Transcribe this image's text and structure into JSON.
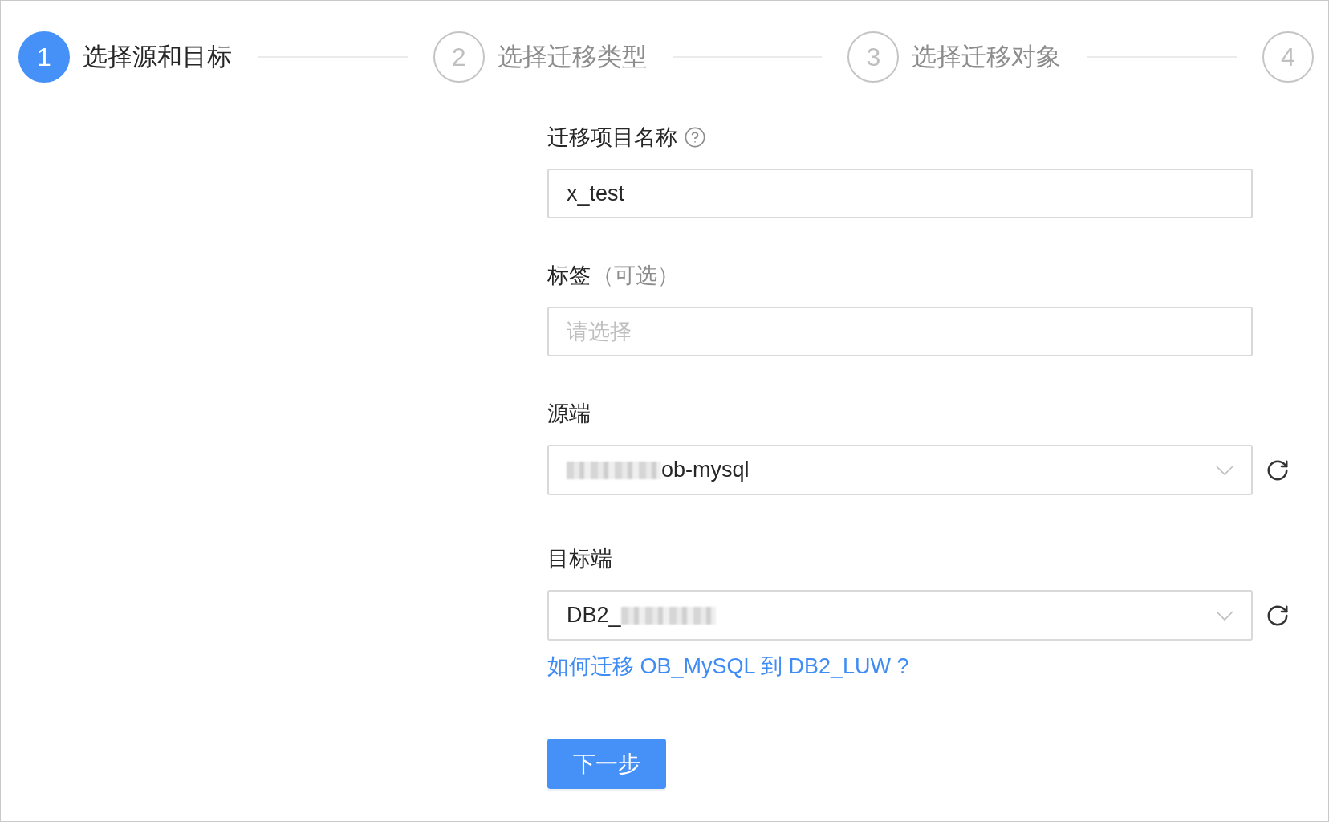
{
  "steps": [
    {
      "number": "1",
      "label": "选择源和目标",
      "current": true
    },
    {
      "number": "2",
      "label": "选择迁移类型",
      "current": false
    },
    {
      "number": "3",
      "label": "选择迁移对象",
      "current": false
    },
    {
      "number": "4",
      "current": false
    }
  ],
  "form": {
    "fields": [
      {
        "kind": "text",
        "label": "迁移项目名称",
        "help": true,
        "value": "x_test"
      },
      {
        "kind": "tags",
        "label": "标签",
        "hint": "（可选）",
        "placeholder": "请选择"
      },
      {
        "kind": "select",
        "label": "源端",
        "value_parts": [
          {
            "kind": "redacted"
          },
          {
            "kind": "text",
            "text": "ob-mysql"
          }
        ],
        "refresh": true
      },
      {
        "kind": "select",
        "label": "目标端",
        "value_parts": [
          {
            "kind": "text",
            "text": "DB2_"
          },
          {
            "kind": "redacted"
          }
        ],
        "refresh": true,
        "link": "如何迁移 OB_MySQL 到 DB2_LUW ?"
      }
    ],
    "submit": "下一步"
  }
}
